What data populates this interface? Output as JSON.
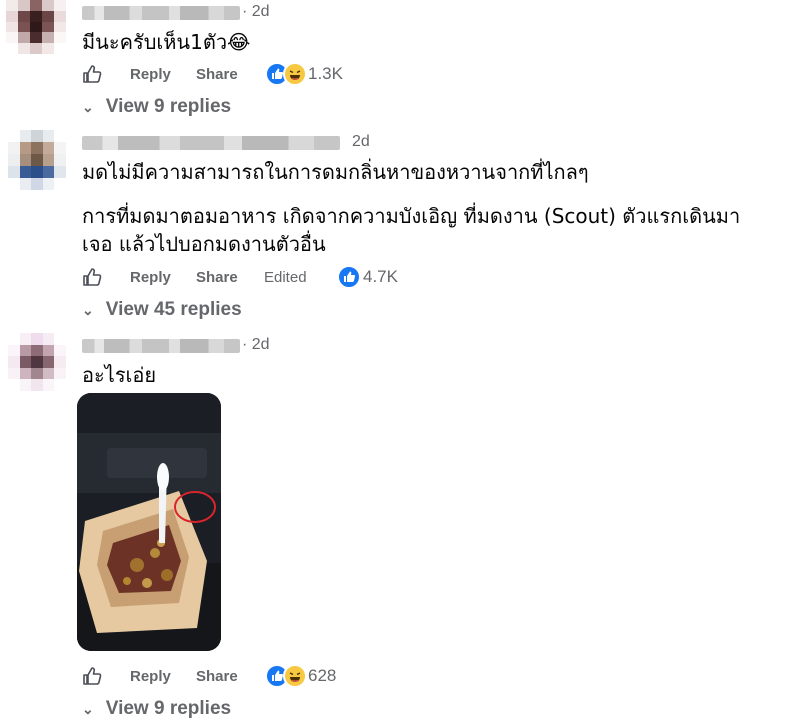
{
  "comments": [
    {
      "time": "· 2d",
      "lines": [
        "มีนะครับเห็น1ตัว😂"
      ],
      "actions": {
        "like": "",
        "reply": "Reply",
        "share": "Share",
        "edited": ""
      },
      "reactions": {
        "types": [
          "like-icon",
          "haha-icon"
        ],
        "count": "1.3K"
      },
      "replies_label": "View 9 replies"
    },
    {
      "time": "2d",
      "lines": [
        "มดไม่มีความสามารถในการดมกลิ่นหาของหวานจากที่ไกลๆ",
        "การที่มดมาตอมอาหาร เกิดจากความบังเอิญ ที่มดงาน (Scout) ตัวแรกเดินมา",
        "เจอ แล้วไปบอกมดงานตัวอื่น"
      ],
      "actions": {
        "reply": "Reply",
        "share": "Share",
        "edited": "Edited"
      },
      "reactions": {
        "types": [
          "like-icon"
        ],
        "count": "4.7K"
      },
      "replies_label": "View 45 replies"
    },
    {
      "time": "· 2d",
      "lines": [
        "อะไรเอ่ย"
      ],
      "actions": {
        "reply": "Reply",
        "share": "Share",
        "edited": ""
      },
      "reactions": {
        "types": [
          "like-icon",
          "haha-icon"
        ],
        "count": "628"
      },
      "replies_label": "View 9 replies"
    }
  ],
  "colors": {
    "accent": "#1877f2",
    "muted": "#65676b",
    "text": "#050505",
    "haha": "#f7c943"
  }
}
